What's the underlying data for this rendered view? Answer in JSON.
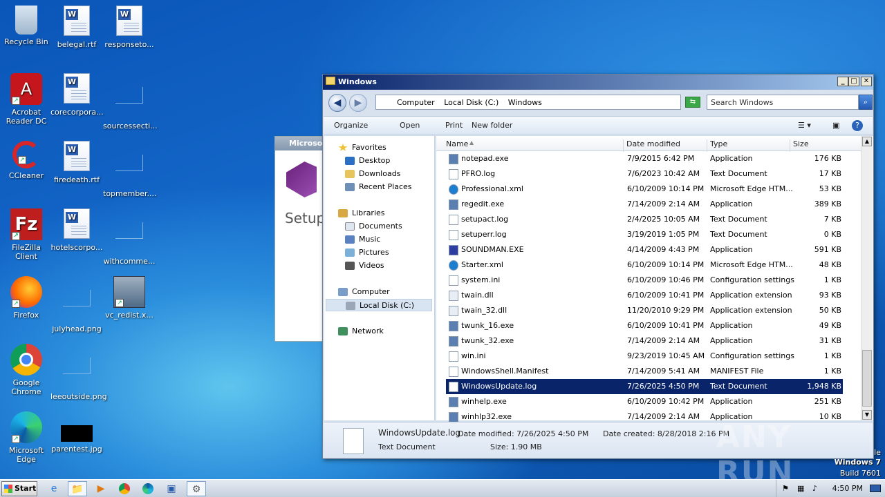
{
  "desktop": {
    "icons": [
      {
        "label": "Recycle Bin"
      },
      {
        "label": "belegal.rtf"
      },
      {
        "label": "responseto..."
      },
      {
        "label": "Acrobat Reader DC"
      },
      {
        "label": "corecorpora..."
      },
      {
        "label": "sourcessecti..."
      },
      {
        "label": "CCleaner"
      },
      {
        "label": "firedeath.rtf"
      },
      {
        "label": "topmember...."
      },
      {
        "label": "FileZilla Client"
      },
      {
        "label": "hotelscorpo..."
      },
      {
        "label": "withcomme..."
      },
      {
        "label": "Firefox"
      },
      {
        "label": "julyhead.png"
      },
      {
        "label": "vc_redist.x..."
      },
      {
        "label": "Google Chrome"
      },
      {
        "label": "leeoutside.png"
      },
      {
        "label": "Microsoft Edge"
      },
      {
        "label": "parentest.jpg"
      }
    ]
  },
  "background_window": {
    "title": "Microso",
    "body": "Setup"
  },
  "explorer": {
    "title": "Windows",
    "controls": {
      "minimize": "_",
      "maximize": "□",
      "close": "✕"
    },
    "breadcrumb": [
      "Computer",
      "Local Disk (C:)",
      "Windows"
    ],
    "search_placeholder": "Search Windows",
    "toolbar": {
      "organize": "Organize",
      "open": "Open",
      "print": "Print",
      "new_folder": "New folder"
    },
    "nav": {
      "favorites": "Favorites",
      "desktop": "Desktop",
      "downloads": "Downloads",
      "recent": "Recent Places",
      "libraries": "Libraries",
      "documents": "Documents",
      "music": "Music",
      "pictures": "Pictures",
      "videos": "Videos",
      "computer": "Computer",
      "local_disk": "Local Disk (C:)",
      "network": "Network"
    },
    "columns": {
      "name": "Name",
      "date": "Date modified",
      "type": "Type",
      "size": "Size"
    },
    "files": [
      {
        "name": "notepad.exe",
        "date": "7/9/2015 6:42 PM",
        "type": "Application",
        "size": "176 KB"
      },
      {
        "name": "PFRO.log",
        "date": "7/6/2023 10:42 AM",
        "type": "Text Document",
        "size": "17 KB"
      },
      {
        "name": "Professional.xml",
        "date": "6/10/2009 10:14 PM",
        "type": "Microsoft Edge HTM...",
        "size": "53 KB"
      },
      {
        "name": "regedit.exe",
        "date": "7/14/2009 2:14 AM",
        "type": "Application",
        "size": "389 KB"
      },
      {
        "name": "setupact.log",
        "date": "2/4/2025 10:05 AM",
        "type": "Text Document",
        "size": "7 KB"
      },
      {
        "name": "setuperr.log",
        "date": "3/19/2019 1:05 PM",
        "type": "Text Document",
        "size": "0 KB"
      },
      {
        "name": "SOUNDMAN.EXE",
        "date": "4/14/2009 4:43 PM",
        "type": "Application",
        "size": "591 KB"
      },
      {
        "name": "Starter.xml",
        "date": "6/10/2009 10:14 PM",
        "type": "Microsoft Edge HTM...",
        "size": "48 KB"
      },
      {
        "name": "system.ini",
        "date": "6/10/2009 10:46 PM",
        "type": "Configuration settings",
        "size": "1 KB"
      },
      {
        "name": "twain.dll",
        "date": "6/10/2009 10:41 PM",
        "type": "Application extension",
        "size": "93 KB"
      },
      {
        "name": "twain_32.dll",
        "date": "11/20/2010 9:29 PM",
        "type": "Application extension",
        "size": "50 KB"
      },
      {
        "name": "twunk_16.exe",
        "date": "6/10/2009 10:41 PM",
        "type": "Application",
        "size": "49 KB"
      },
      {
        "name": "twunk_32.exe",
        "date": "7/14/2009 2:14 AM",
        "type": "Application",
        "size": "31 KB"
      },
      {
        "name": "win.ini",
        "date": "9/23/2019 10:45 AM",
        "type": "Configuration settings",
        "size": "1 KB"
      },
      {
        "name": "WindowsShell.Manifest",
        "date": "7/14/2009 5:41 AM",
        "type": "MANIFEST File",
        "size": "1 KB"
      },
      {
        "name": "WindowsUpdate.log",
        "date": "7/26/2025 4:50 PM",
        "type": "Text Document",
        "size": "1,948 KB"
      },
      {
        "name": "winhelp.exe",
        "date": "6/10/2009 10:42 PM",
        "type": "Application",
        "size": "251 KB"
      },
      {
        "name": "winhlp32.exe",
        "date": "7/14/2009 2:14 AM",
        "type": "Application",
        "size": "10 KB"
      }
    ],
    "details": {
      "filename": "WindowsUpdate.log",
      "date_modified": "Date modified: 7/26/2025 4:50 PM",
      "date_created": "Date created: 8/28/2018 2:16 PM",
      "type": "Text Document",
      "size": "Size: 1.90 MB"
    }
  },
  "taskbar": {
    "start": "Start",
    "clock": "4:50 PM"
  },
  "watermark": {
    "line1": "le",
    "line2": "Windows 7",
    "line3": "Build 7601",
    "brand": "ANY RUN"
  }
}
